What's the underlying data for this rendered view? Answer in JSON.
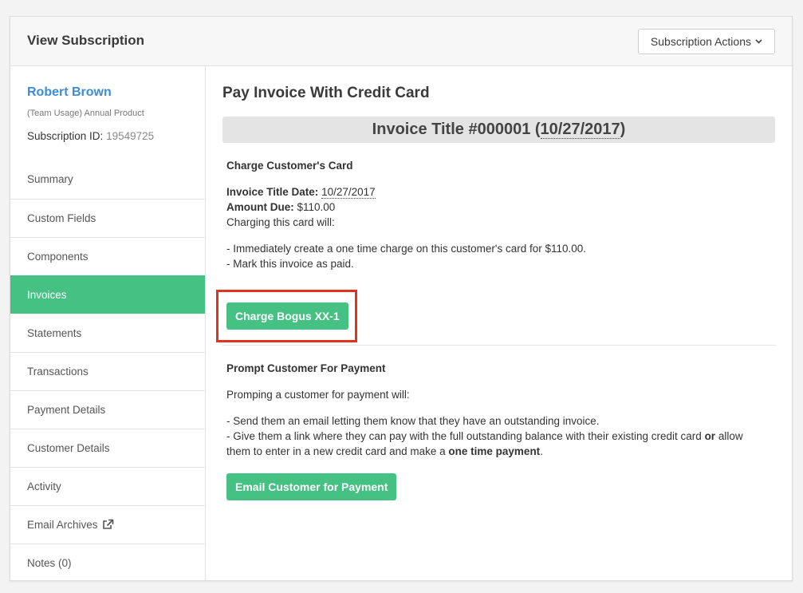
{
  "header": {
    "title": "View Subscription",
    "actions_label": "Subscription Actions"
  },
  "customer": {
    "name": "Robert Brown",
    "product": "(Team Usage) Annual Product",
    "subscription_id_label": "Subscription ID:",
    "subscription_id": "19549725"
  },
  "nav": [
    {
      "label": "Summary",
      "active": false
    },
    {
      "label": "Custom Fields",
      "active": false
    },
    {
      "label": "Components",
      "active": false
    },
    {
      "label": "Invoices",
      "active": true
    },
    {
      "label": "Statements",
      "active": false
    },
    {
      "label": "Transactions",
      "active": false
    },
    {
      "label": "Payment Details",
      "active": false
    },
    {
      "label": "Customer Details",
      "active": false
    },
    {
      "label": "Activity",
      "active": false
    },
    {
      "label": "Email Archives",
      "active": false
    },
    {
      "label": "Notes (0)",
      "active": false
    }
  ],
  "main": {
    "title": "Pay Invoice With Credit Card",
    "invoice_title": "Invoice Title #000001 (",
    "invoice_date": "10/27/2017",
    "invoice_title_close": ")",
    "charge_section": {
      "title": "Charge Customer's Card",
      "date_label": "Invoice Title Date:",
      "date_value": "10/27/2017",
      "amount_label": "Amount Due:",
      "amount_value": "$110.00",
      "intro": "Charging this card will:",
      "bullet1": "- Immediately create a one time charge on this customer's card for $110.00.",
      "bullet2": "- Mark this invoice as paid.",
      "button": "Charge Bogus XX-1"
    },
    "prompt_section": {
      "title": "Prompt Customer For Payment",
      "intro": "Promping a customer for payment will:",
      "bullet1": "- Send them an email letting them know that they have an outstanding invoice.",
      "bullet2_a": "- Give them a link where they can pay with the full outstanding balance with their existing credit card ",
      "bullet2_or": "or",
      "bullet2_b": " allow",
      "bullet2_c": "them to enter in a new credit card and make a ",
      "bullet2_bold": "one time payment",
      "bullet2_end": ".",
      "button": "Email Customer for Payment"
    }
  },
  "colors": {
    "accent": "#45c183",
    "link": "#3c8dd6",
    "highlight": "#e0331b"
  }
}
